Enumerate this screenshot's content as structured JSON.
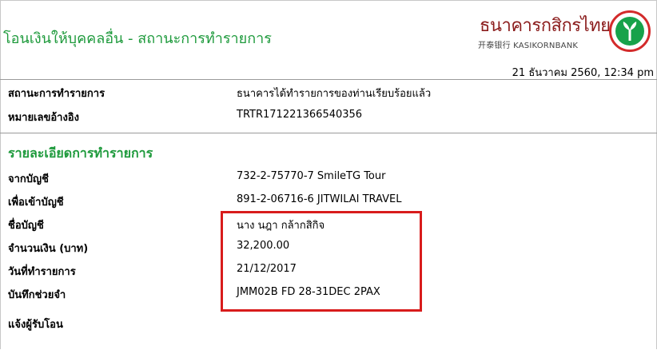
{
  "header": {
    "title": "โอนเงินให้บุคคลอื่น - สถานะการทำรายการ",
    "bank_name_th": "ธนาคารกสิกรไทย",
    "bank_name_en": "开泰银行 KASIKORNBANK",
    "datetime": "21 ธันวาคม 2560, 12:34 pm"
  },
  "status": {
    "label": "สถานะการทำรายการ",
    "value": "ธนาคารได้ทำรายการของท่านเรียบร้อยแล้ว"
  },
  "reference": {
    "label": "หมายเลขอ้างอิง",
    "value": "TRTR171221366540356"
  },
  "details": {
    "title": "รายละเอียดการทำรายการ",
    "from_account": {
      "label": "จากบัญชี",
      "value": "732-2-75770-7 SmileTG Tour"
    },
    "to_account": {
      "label": "เพื่อเข้าบัญชี",
      "value": "891-2-06716-6 JITWILAI TRAVEL"
    },
    "account_name": {
      "label": "ชื่อบัญชี",
      "value": "นาง นฎา กล้ากสิกิจ"
    },
    "amount": {
      "label": "จำนวนเงิน (บาท)",
      "value": "32,200.00"
    },
    "date": {
      "label": "วันที่ทำรายการ",
      "value": "21/12/2017"
    },
    "memo": {
      "label": "บันทึกช่วยจำ",
      "value": "JMM02B FD 28-31DEC 2PAX"
    },
    "notify": {
      "label": "แจ้งผู้รับโอน",
      "value": ""
    }
  },
  "colors": {
    "title_green": "#1e9a3c",
    "bank_red": "#8b1d1d",
    "highlight_red": "#d81c1c"
  }
}
